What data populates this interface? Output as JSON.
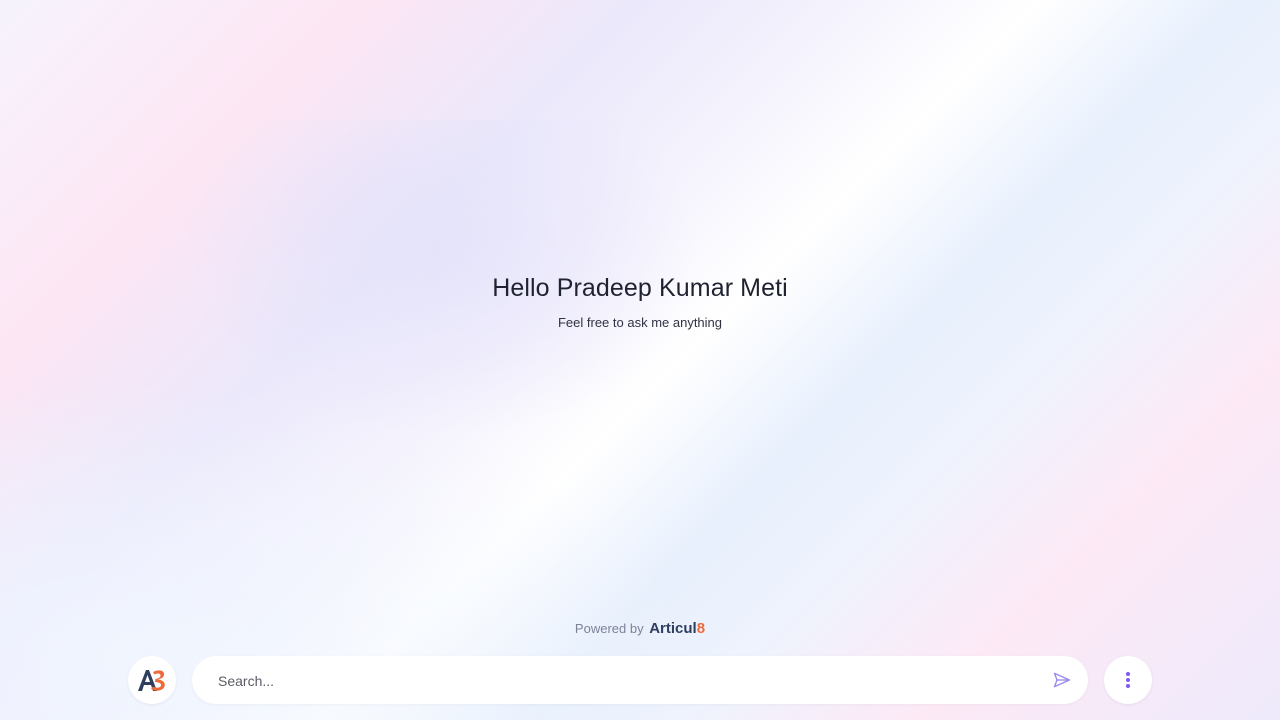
{
  "greeting": {
    "title": "Hello Pradeep Kumar Meti",
    "subtitle": "Feel free to ask me anything"
  },
  "footer": {
    "powered_by": "Powered by",
    "brand_main": "Articul",
    "brand_accent": "8"
  },
  "search": {
    "placeholder": "Search...",
    "value": ""
  },
  "icons": {
    "logo": "a8-logo-icon",
    "send": "send-icon",
    "menu": "more-vertical-icon"
  },
  "colors": {
    "brand_dark": "#2f3e5c",
    "brand_accent": "#ee6a3b",
    "icon_purple": "#8b6ff0"
  }
}
